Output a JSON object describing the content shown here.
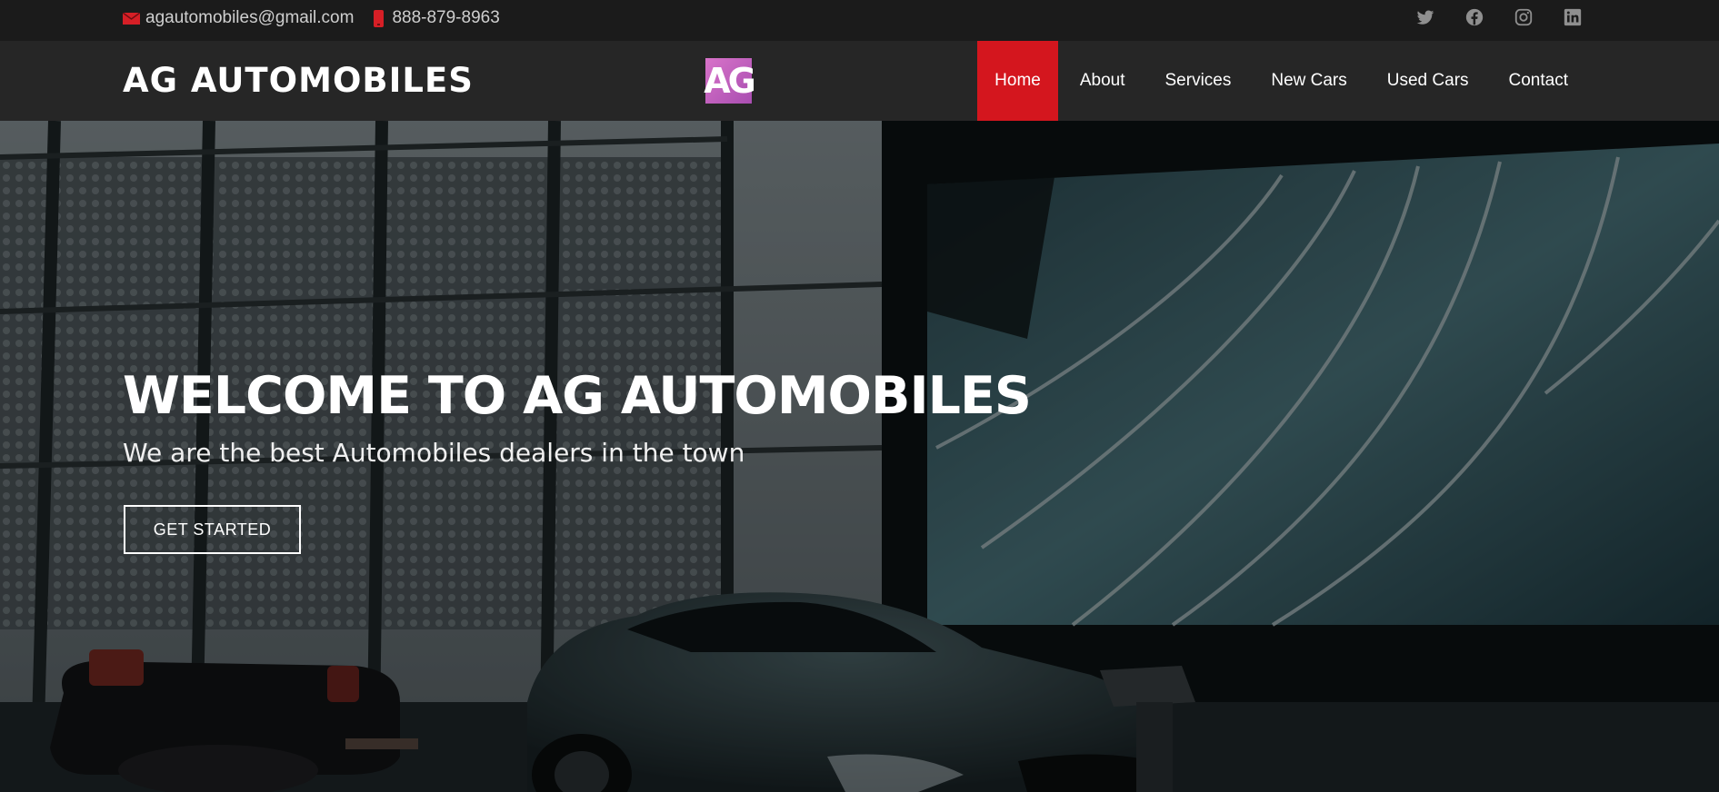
{
  "topbar": {
    "email": "agautomobiles@gmail.com",
    "phone": "888-879-8963",
    "social": [
      "twitter-icon",
      "facebook-icon",
      "instagram-icon",
      "linkedin-icon"
    ]
  },
  "header": {
    "brand": "AG AUTOMOBILES",
    "logo_text": "AG",
    "nav": [
      {
        "label": "Home",
        "active": true
      },
      {
        "label": "About"
      },
      {
        "label": "Services"
      },
      {
        "label": "New Cars"
      },
      {
        "label": "Used Cars"
      },
      {
        "label": "Contact"
      }
    ]
  },
  "hero": {
    "title": "WELCOME TO AG AUTOMOBILES",
    "subtitle": "We are the best Automobiles dealers in the town",
    "cta": "GET STARTED"
  },
  "colors": {
    "accent": "#d4161e",
    "topbar_bg": "#1b1b1b",
    "header_bg": "#262626",
    "logo": "#c864c0"
  }
}
